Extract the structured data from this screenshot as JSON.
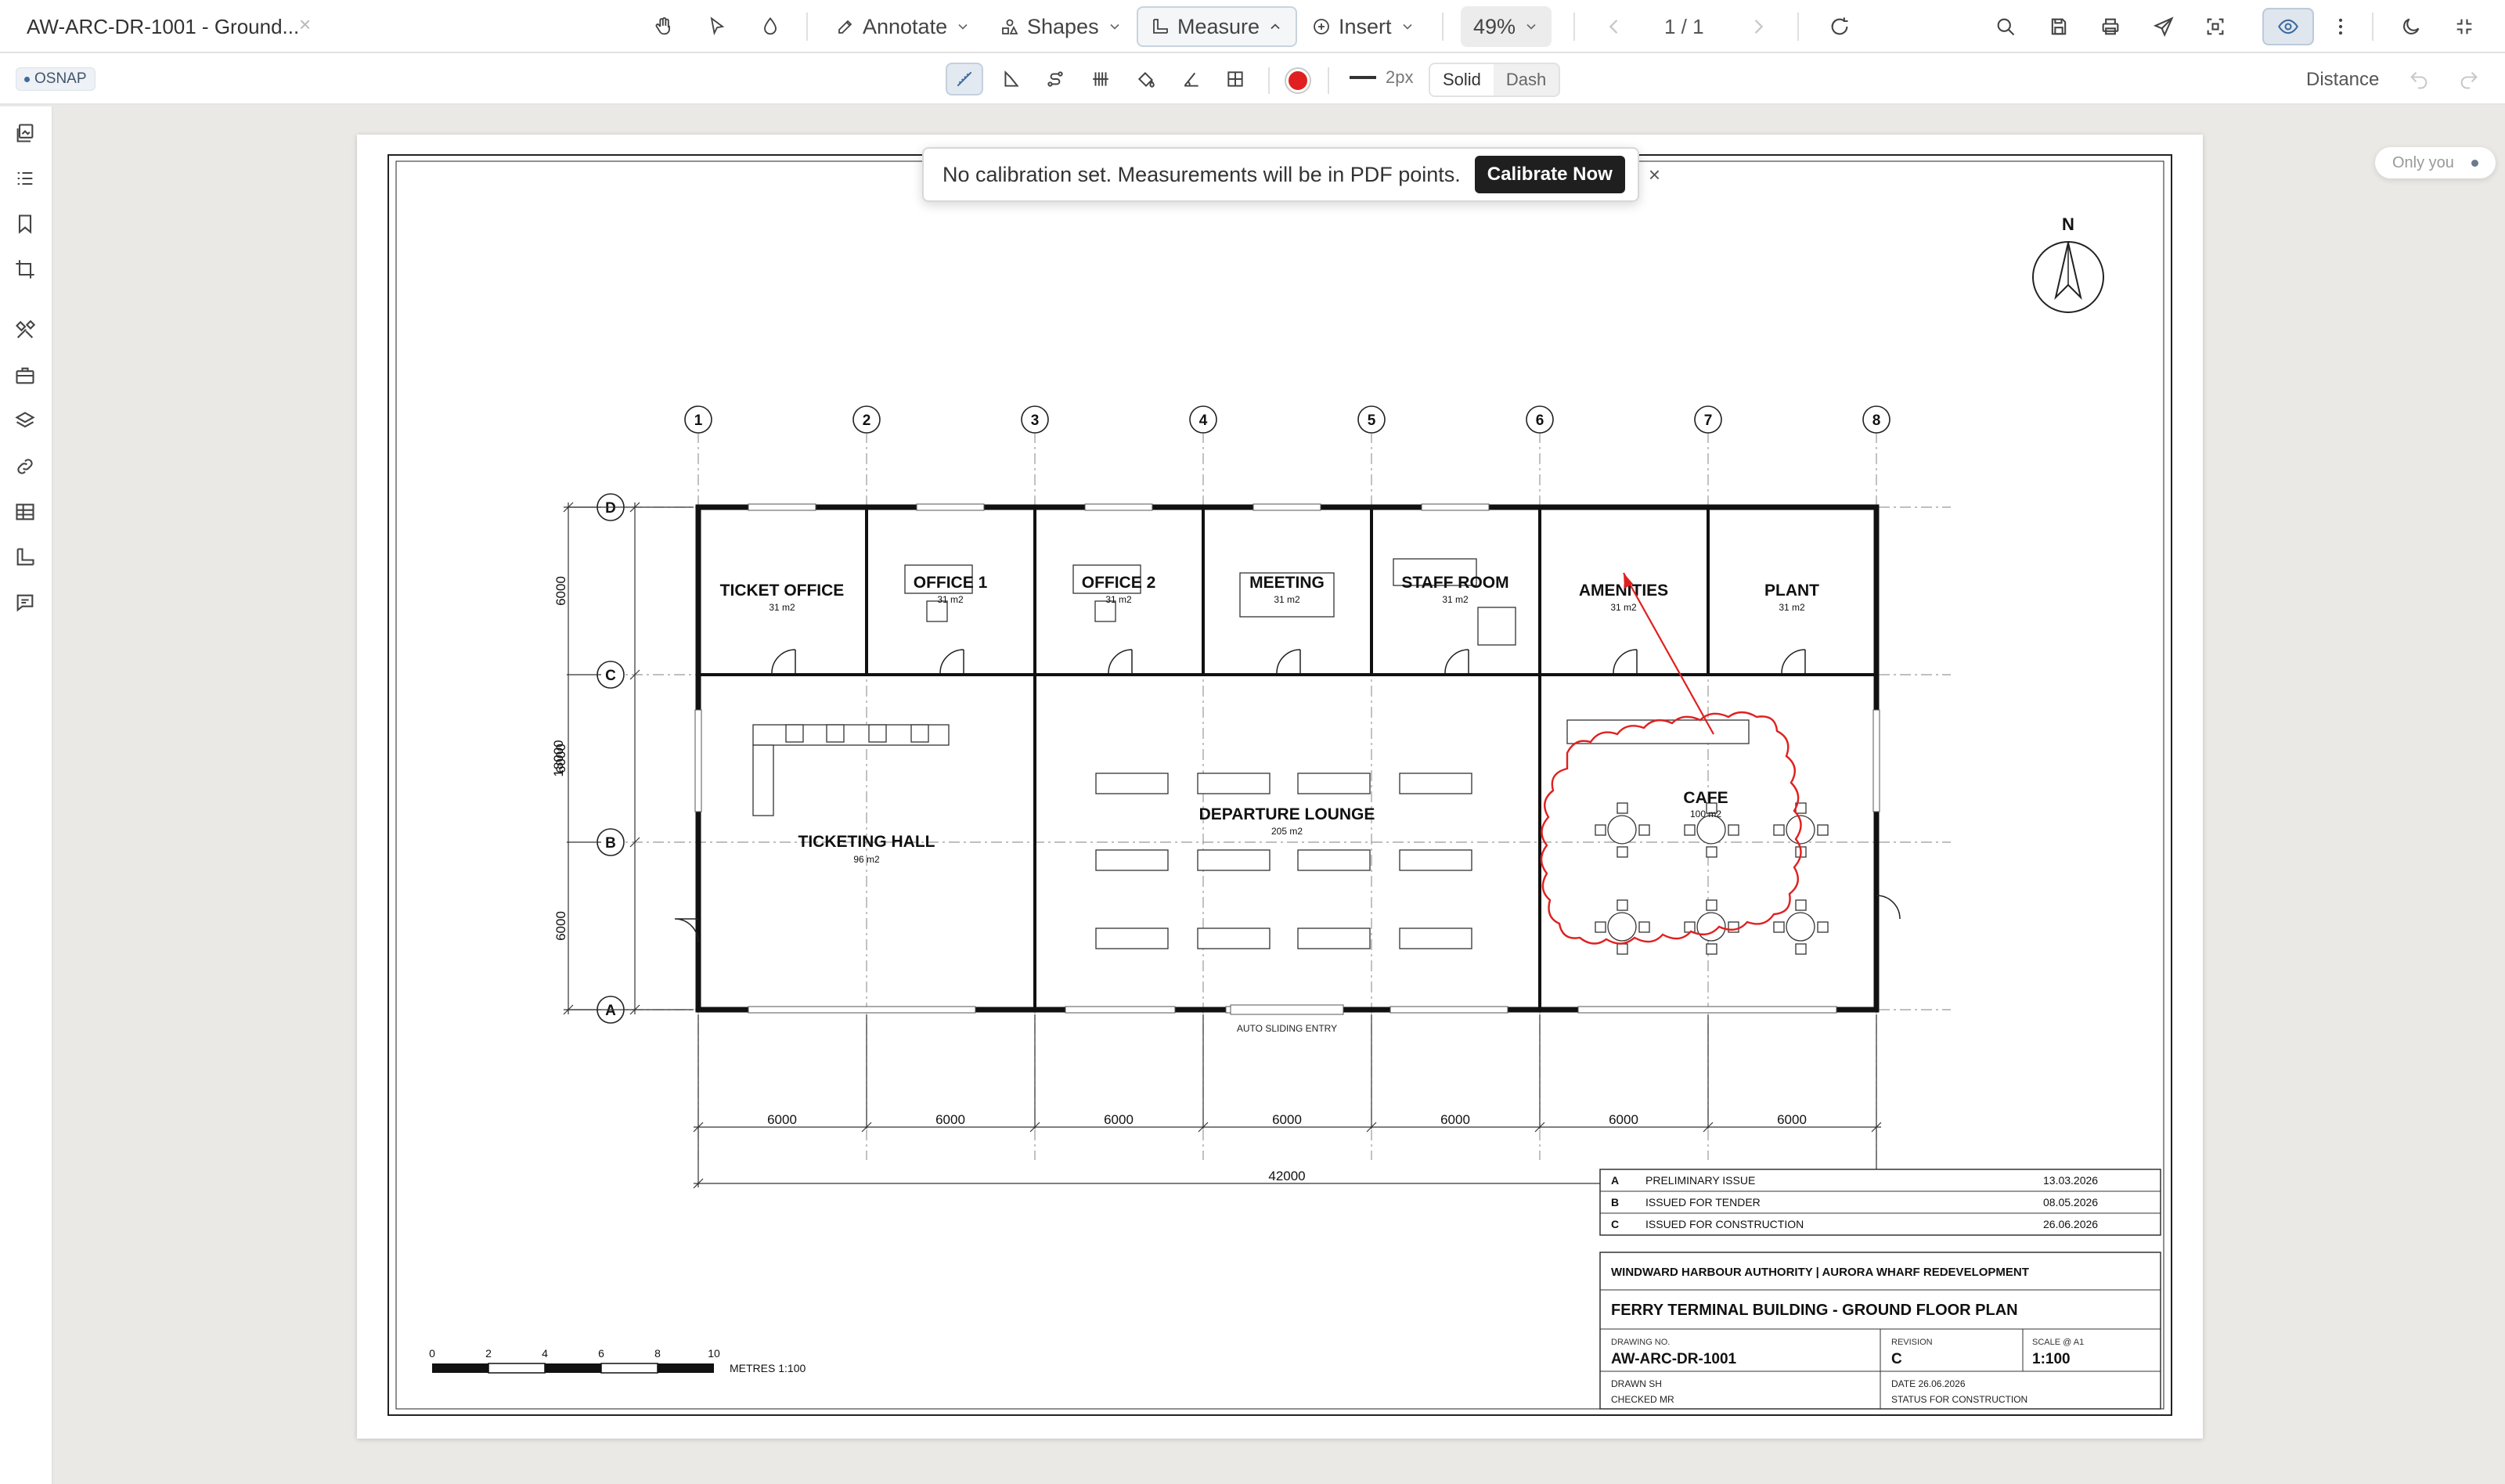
{
  "app": {
    "doc_title": "AW-ARC-DR-1001 - Ground...",
    "tab_close": "×"
  },
  "toolbar": {
    "annotate": "Annotate",
    "shapes": "Shapes",
    "measure": "Measure",
    "insert": "Insert",
    "zoom": "49%",
    "page_indicator": "1 / 1"
  },
  "subtoolbar": {
    "osnap": "OSNAP",
    "stroke_size": "2px",
    "style_solid": "Solid",
    "style_dash": "Dash",
    "mode": "Distance",
    "stroke_color": "#e02020"
  },
  "banner": {
    "text": "No calibration set. Measurements will be in PDF points.",
    "button": "Calibrate Now",
    "close": "×"
  },
  "presence": {
    "label": "Only you"
  },
  "drawing": {
    "north": "N",
    "grid_cols": [
      "1",
      "2",
      "3",
      "4",
      "5",
      "6",
      "7",
      "8"
    ],
    "grid_rows": [
      "D",
      "C",
      "B",
      "A"
    ],
    "rooms": [
      {
        "name": "TICKET OFFICE",
        "area": "31 m2"
      },
      {
        "name": "OFFICE 1",
        "area": "31 m2"
      },
      {
        "name": "OFFICE 2",
        "area": "31 m2"
      },
      {
        "name": "MEETING",
        "area": "31 m2"
      },
      {
        "name": "STAFF ROOM",
        "area": "31 m2"
      },
      {
        "name": "AMENITIES",
        "area": "31 m2"
      },
      {
        "name": "PLANT",
        "area": "31 m2"
      },
      {
        "name": "TICKETING HALL",
        "area": "96 m2"
      },
      {
        "name": "DEPARTURE LOUNGE",
        "area": "205 m2"
      },
      {
        "name": "CAFE",
        "area": "100 m2"
      }
    ],
    "bay_dims": [
      "6000",
      "6000",
      "6000",
      "6000",
      "6000",
      "6000",
      "6000"
    ],
    "overall_dim": "42000",
    "row_dims": [
      "6000",
      "6000",
      "6000"
    ],
    "overall_row_dim": "18000",
    "entry_label": "AUTO SLIDING ENTRY",
    "scale_bar": {
      "ticks": [
        "0",
        "2",
        "4",
        "6",
        "8",
        "10"
      ],
      "label": "METRES 1:100"
    },
    "revisions": [
      {
        "rev": "A",
        "desc": "PRELIMINARY ISSUE",
        "date": "13.03.2026"
      },
      {
        "rev": "B",
        "desc": "ISSUED FOR TENDER",
        "date": "08.05.2026"
      },
      {
        "rev": "C",
        "desc": "ISSUED FOR CONSTRUCTION",
        "date": "26.06.2026"
      }
    ],
    "title_block": {
      "client": "WINDWARD HARBOUR AUTHORITY | AURORA WHARF REDEVELOPMENT",
      "title": "FERRY TERMINAL BUILDING - GROUND FLOOR PLAN",
      "drawing_no_label": "DRAWING NO.",
      "drawing_no": "AW-ARC-DR-1001",
      "revision_label": "REVISION",
      "revision": "C",
      "scale_label": "SCALE @ A1",
      "scale": "1:100",
      "drawn": "DRAWN  SH",
      "checked": "CHECKED  MR",
      "date": "DATE  26.06.2026",
      "status": "STATUS  FOR CONSTRUCTION"
    }
  }
}
